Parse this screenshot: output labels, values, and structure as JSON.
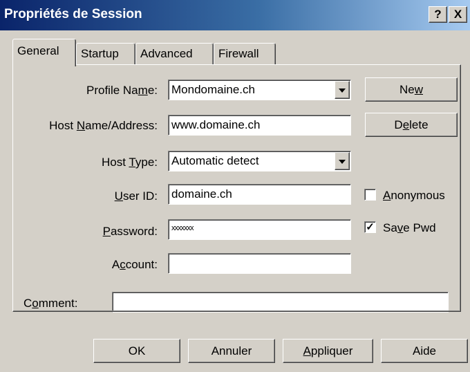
{
  "window": {
    "title": "Propriétés de Session",
    "help_glyph": "?",
    "close_glyph": "X"
  },
  "tabs": [
    {
      "label": "General",
      "active": true
    },
    {
      "label": "Startup",
      "active": false
    },
    {
      "label": "Advanced",
      "active": false
    },
    {
      "label": "Firewall",
      "active": false
    }
  ],
  "form": {
    "profile_name": {
      "pre": "Profile Na",
      "ul": "m",
      "post": "e:",
      "value": "Mondomaine.ch"
    },
    "host_name": {
      "pre": "Host ",
      "ul": "N",
      "post": "ame/Address:",
      "value": "www.domaine.ch"
    },
    "host_type": {
      "pre": "Host ",
      "ul": "T",
      "post": "ype:",
      "value": "Automatic detect"
    },
    "user_id": {
      "pre": "",
      "ul": "U",
      "post": "ser ID:",
      "value": "domaine.ch"
    },
    "password": {
      "pre": "",
      "ul": "P",
      "post": "assword:",
      "value": "xxxxxxx"
    },
    "account": {
      "pre": "A",
      "ul": "c",
      "post": "count:",
      "value": ""
    },
    "comment": {
      "pre": "C",
      "ul": "o",
      "post": "mment:",
      "value": ""
    }
  },
  "side_buttons": {
    "new": {
      "pre": "Ne",
      "ul": "w",
      "post": ""
    },
    "delete": {
      "pre": "D",
      "ul": "e",
      "post": "lete"
    }
  },
  "checkboxes": {
    "anonymous": {
      "pre": "",
      "ul": "A",
      "post": "nonymous",
      "checked": false,
      "mark": ""
    },
    "save_pwd": {
      "pre": "Sa",
      "ul": "v",
      "post": "e Pwd",
      "checked": true,
      "mark": "✓"
    }
  },
  "bottom_buttons": {
    "ok": {
      "label": "OK"
    },
    "cancel": {
      "label": "Annuler"
    },
    "apply": {
      "pre": "",
      "ul": "A",
      "post": "ppliquer"
    },
    "help": {
      "label": "Aide"
    }
  }
}
